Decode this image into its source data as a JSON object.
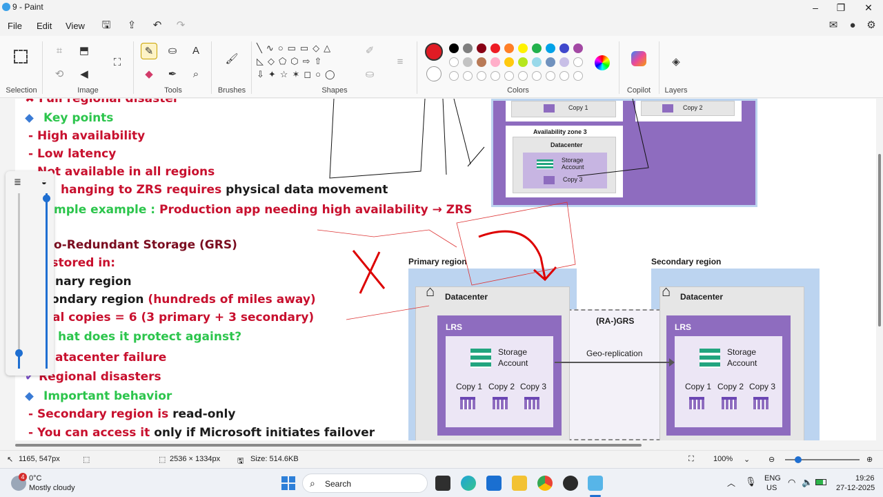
{
  "window": {
    "title": "9 - Paint"
  },
  "menu": [
    "File",
    "Edit",
    "View"
  ],
  "ribbon": {
    "groups": [
      "Selection",
      "Image",
      "Tools",
      "Brushes",
      "Shapes",
      "Colors",
      "Copilot",
      "Layers"
    ]
  },
  "colors": {
    "primary": "#e01b24",
    "row1": [
      "#000000",
      "#7f7f7f",
      "#880015",
      "#ed1c24",
      "#ff7f27",
      "#fff200",
      "#22b14c",
      "#00a2e8",
      "#3f48cc",
      "#a349a4"
    ],
    "row2": [
      "#ffffff",
      "#c3c3c3",
      "#b97a57",
      "#ffaec9",
      "#ffc90e",
      "#b5e61d",
      "#99d9ea",
      "#7092be",
      "#c8bfe7",
      "#ffffff"
    ]
  },
  "notes": {
    "l1": "Full regional disaster",
    "l2": "Key points",
    "l3": "-  High availability",
    "l4": "-  Low latency",
    "l5": "-  Not available in all regions",
    "l6a": "hanging to ZRS requires ",
    "l6b": "physical data movement",
    "l7a": "mple example : ",
    "l7b": "Production app needing high availability → ZRS",
    "l8": "o-Redundant Storage (GRS)",
    "l9": "a  s stored in:",
    "l10": "nary region",
    "l11a": "ondary region ",
    "l11b": "(hundreds of miles away)",
    "l12": "al copies = 6 (3 primary + 3 secondary)",
    "l13": "hat does it protect against?",
    "l14": "atacenter failure",
    "l15": "Regional disasters",
    "l16": "Important behavior",
    "l17a": "-  Secondary region is ",
    "l17b": "read-only",
    "l18a": "-  You can access it ",
    "l18b": "only if Microsoft initiates failover"
  },
  "diagram_top": {
    "zone": "Availability zone 3",
    "datacenter": "Datacenter",
    "storage": "Storage Account",
    "copy_a": "Copy 1",
    "copy_b": "Copy 2",
    "copy_c": "Copy 3"
  },
  "diagram_grs": {
    "primary": "Primary region",
    "secondary": "Secondary region",
    "datacenter": "Datacenter",
    "ragrs": "(RA-)GRS",
    "lrs": "LRS",
    "storage1": "Storage",
    "storage2": "Account",
    "georep": "Geo-replication",
    "copy1": "Copy 1",
    "copy2": "Copy 2",
    "copy3": "Copy 3"
  },
  "status": {
    "cursor": "1165, 547px",
    "dimensions": "2536 × 1334px",
    "size": "Size: 514.6KB",
    "zoom": "100%"
  },
  "taskbar": {
    "weather_temp": "0°C",
    "weather_desc": "Mostly cloudy",
    "badge": "4",
    "search": "Search",
    "lang1": "ENG",
    "lang2": "US",
    "time": "19:26",
    "date": "27-12-2025"
  }
}
